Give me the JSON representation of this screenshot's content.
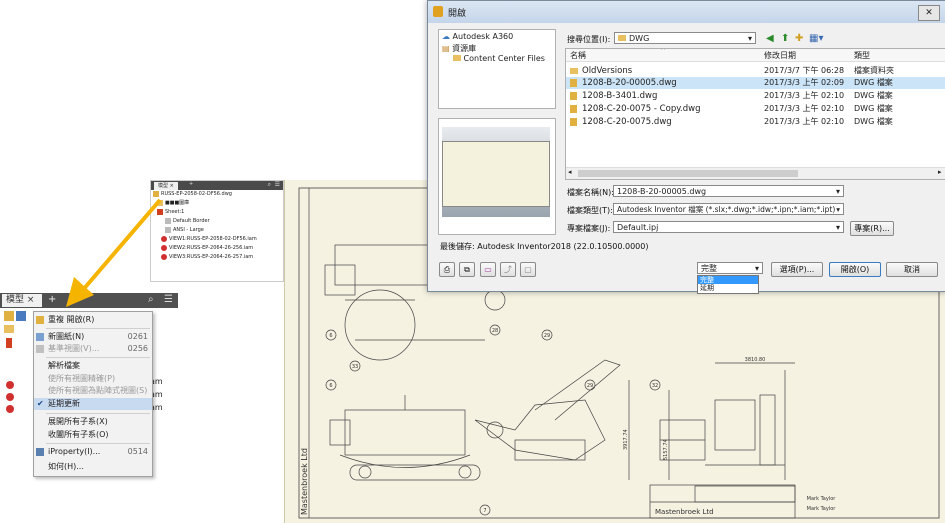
{
  "browser_small": {
    "tab": "模型",
    "close": "×",
    "plus": "+",
    "tree": [
      "RUSS-EP-2058-02-DF56.dwg",
      "■■■圖庫",
      "Sheet:1",
      "Default Border",
      "ANSI - Large",
      "VIEW1:RUSS-EP-2058-02-DF56.iam",
      "VIEW2:RUSS-EP-2064-26-256.iam",
      "VIEW3:RUSS-EP-2064-26-257.iam"
    ]
  },
  "browser_large": {
    "tab": "模型",
    "close": "×",
    "plus": "+",
    "right_texts": [
      "am",
      "am",
      "am"
    ]
  },
  "context_menu": {
    "items": [
      {
        "label": "重複 開啟(R)",
        "shortcut": "",
        "disabled": false
      },
      {
        "label": "新圖紙(N)",
        "shortcut": "0261",
        "disabled": false
      },
      {
        "label": "基準視圖(V)...",
        "shortcut": "0256",
        "disabled": true
      },
      {
        "label": "解析檔案",
        "shortcut": "",
        "disabled": false
      },
      {
        "label": "使所有視圖精確(P)",
        "shortcut": "",
        "disabled": true
      },
      {
        "label": "使所有視圖為點陣式視圖(S)",
        "shortcut": "",
        "disabled": true
      },
      {
        "label": "延期更新",
        "shortcut": "",
        "disabled": false
      },
      {
        "label": "展開所有子系(X)",
        "shortcut": "",
        "disabled": false
      },
      {
        "label": "收闔所有子系(O)",
        "shortcut": "",
        "disabled": false
      },
      {
        "label": "iProperty(I)...",
        "shortcut": "0514",
        "disabled": false
      },
      {
        "label": "如何(H)...",
        "shortcut": "",
        "disabled": false
      }
    ]
  },
  "dialog": {
    "title": "開啟",
    "places": [
      "Autodesk A360",
      "資源庫",
      "Content Center Files"
    ],
    "look_in_label": "搜尋位置(I):",
    "look_in_value": "DWG",
    "columns": [
      "名稱",
      "修改日期",
      "類型"
    ],
    "files": [
      {
        "name": "OldVersions",
        "date": "2017/3/7 下午 06:28",
        "type": "檔案資料夾",
        "folder": true
      },
      {
        "name": "1208-B-20-00005.dwg",
        "date": "2017/3/3 上午 02:09",
        "type": "DWG 檔案",
        "folder": false
      },
      {
        "name": "1208-B-3401.dwg",
        "date": "2017/3/3 上午 02:10",
        "type": "DWG 檔案",
        "folder": false
      },
      {
        "name": "1208-C-20-0075 - Copy.dwg",
        "date": "2017/3/3 上午 02:10",
        "type": "DWG 檔案",
        "folder": false
      },
      {
        "name": "1208-C-20-0075.dwg",
        "date": "2017/3/3 上午 02:10",
        "type": "DWG 檔案",
        "folder": false
      }
    ],
    "filename_label": "檔案名稱(N):",
    "filename_value": "1208-B-20-00005.dwg",
    "filetype_label": "檔案類型(T):",
    "filetype_value": "Autodesk Inventor 檔案 (*.slx;*.dwg;*.idw;*.ipn;*.iam;*.ipt)",
    "project_label": "專案檔案(J):",
    "project_value": "Default.ipj",
    "project_button": "專案(R)...",
    "last_saved": "最後儲存: Autodesk Inventor2018 (22.0.10500.0000)",
    "mode_value": "完整",
    "mode_options": [
      "完整",
      "延期"
    ],
    "options_button": "選項(P)...",
    "open_button": "開啟(O)",
    "cancel_button": "取消"
  },
  "drawing": {
    "side_text": "Mastenbroek Ltd",
    "title_text": "Mastenbroek Ltd",
    "balloons": [
      "6",
      "28",
      "29",
      "33",
      "6",
      "29",
      "32",
      "7"
    ],
    "dims": [
      "3810.80",
      "3917.74",
      "5157.74"
    ],
    "small_text": [
      "Mark Taylor",
      "Mark Taylor"
    ]
  },
  "colors": {
    "arrow": "#f5b400",
    "drawing_bg": "#f5f2e1",
    "selection": "#cce4f7"
  }
}
